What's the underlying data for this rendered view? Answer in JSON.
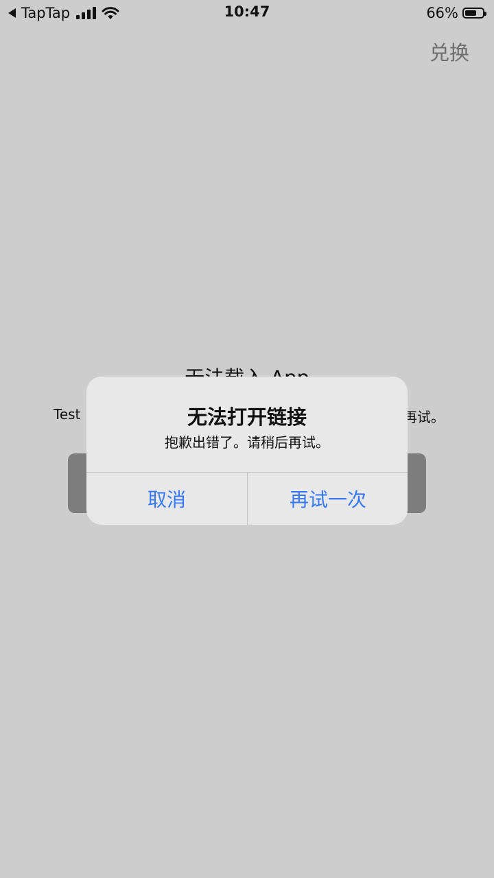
{
  "status_bar": {
    "back_app": "TapTap",
    "time": "10:47",
    "battery_percent": "66%",
    "battery_level": 0.66
  },
  "header": {
    "redeem_label": "兑换"
  },
  "background": {
    "title": "无法载入 App",
    "message_start": "Test",
    "message_end": "再试。"
  },
  "alert": {
    "title": "无法打开链接",
    "message": "抱歉出错了。请稍后再试。",
    "cancel_label": "取消",
    "retry_label": "再试一次",
    "button_color": "#3478f6"
  }
}
